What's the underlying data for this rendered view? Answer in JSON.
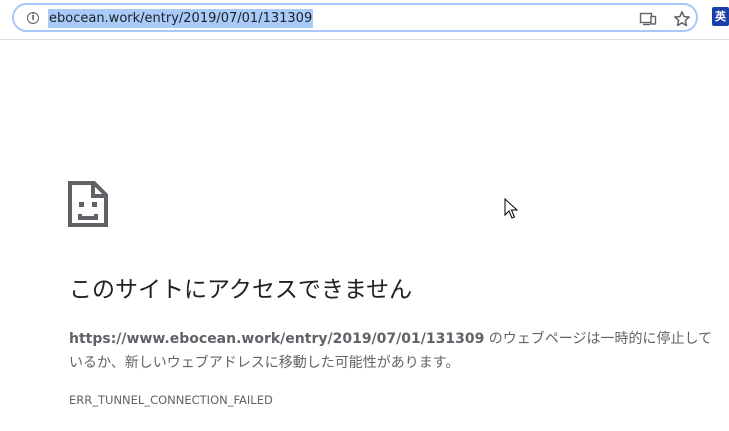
{
  "toolbar": {
    "url": "ebocean.work/entry/2019/07/01/131309",
    "extension_label": "英",
    "icons": {
      "info": "info-icon",
      "cast": "cast-icon",
      "bookmark": "star-icon",
      "extension": "extension-icon"
    }
  },
  "error_page": {
    "icon": "sad-page-icon",
    "title": "このサイトにアクセスできません",
    "description_url": "https://www.ebocean.work/entry/2019/07/01/131309",
    "description_text": " のウェブページは一時的に停止しているか、新しいウェブアドレスに移動した可能性があります。",
    "error_code": "ERR_TUNNEL_CONNECTION_FAILED"
  },
  "colors": {
    "omnibox_border": "#a8c7fa",
    "selection": "#a9cbfa",
    "title_text": "#202124",
    "body_text": "#5f6368",
    "extension_bg": "#1a3fa8"
  }
}
